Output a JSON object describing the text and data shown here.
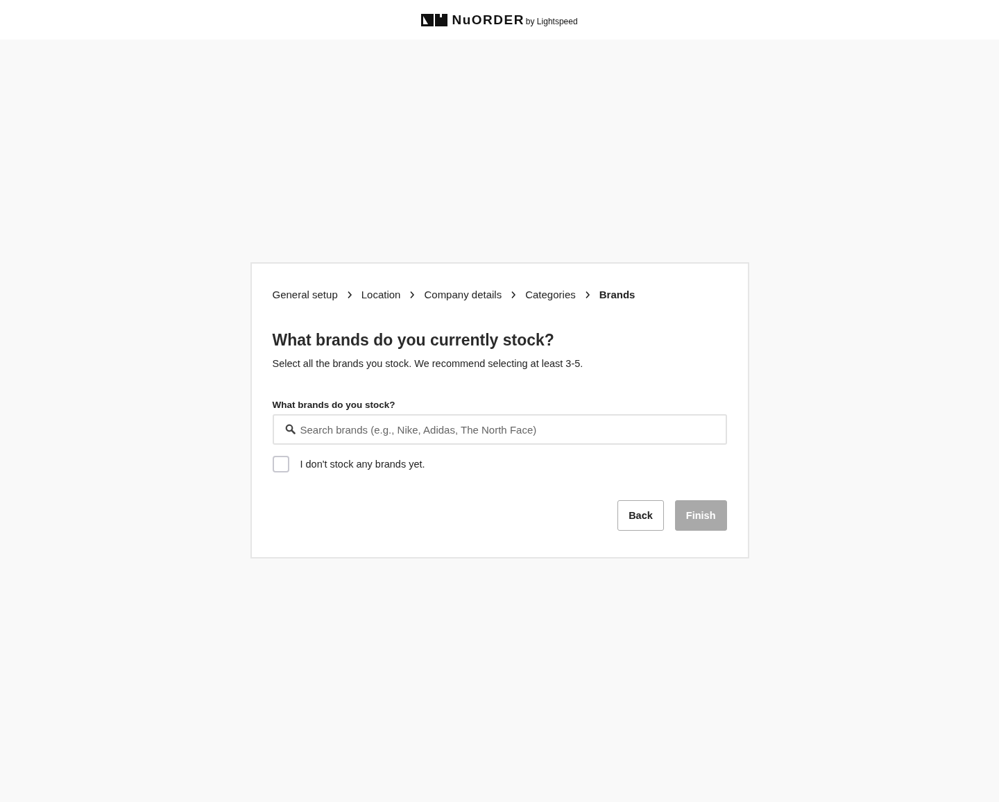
{
  "header": {
    "logo_name": "NuORDER",
    "logo_suffix": "by Lightspeed"
  },
  "breadcrumbs": [
    {
      "label": "General setup",
      "selected": false
    },
    {
      "label": "Location",
      "selected": false
    },
    {
      "label": "Company details",
      "selected": false
    },
    {
      "label": "Categories",
      "selected": false
    },
    {
      "label": "Brands",
      "selected": true
    }
  ],
  "title": "What brands do you currently stock?",
  "subtitle": "Select all the brands you stock. We recommend selecting at least 3-5.",
  "field": {
    "label": "What brands do you stock?",
    "placeholder": "Search brands (e.g., Nike, Adidas, The North Face)"
  },
  "checkbox": {
    "label": "I don't stock any brands yet.",
    "checked": false
  },
  "buttons": [
    {
      "label": "Back",
      "disabled": false
    },
    {
      "label": "Finish",
      "disabled": true
    }
  ]
}
